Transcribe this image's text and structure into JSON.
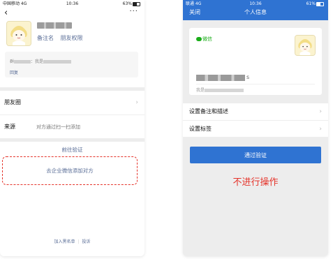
{
  "left_phone": {
    "status_bar": {
      "carrier": "中国移动 4G",
      "time": "10:36",
      "battery": "63%"
    },
    "nav": {
      "back_icon": "chevron-left-icon",
      "more_icon": "more-icon",
      "more_label": "···"
    },
    "profile": {
      "remark_label": "备注名",
      "permission_label": "朋友权限"
    },
    "greeting": {
      "prefix": "群",
      "middle": "：我是",
      "reply_label": "回复"
    },
    "rows": [
      {
        "label": "朋友圈",
        "value": ""
      },
      {
        "label": "来源",
        "value": "对方通过扫一扫添加"
      }
    ],
    "actions": {
      "verify_label": "前往验证",
      "add_via_wecom_label": "去企业微信添加对方"
    },
    "footer": {
      "blacklist_label": "加入黑名单",
      "separator": "|",
      "report_label": "投诉"
    }
  },
  "right_phone": {
    "status_bar": {
      "carrier": "联通 4G",
      "time": "10:36",
      "battery": "61%"
    },
    "nav": {
      "close_label": "关闭",
      "title": "个人信息"
    },
    "card": {
      "wechat_label": "微信",
      "name_suffix": "s",
      "id_prefix": "我是"
    },
    "rows": [
      {
        "label": "设置备注和描述"
      },
      {
        "label": "设置标签"
      }
    ],
    "verify_button_label": "通过验证",
    "note": "不进行操作"
  },
  "colors": {
    "link_blue": "#576b95",
    "wecom_blue": "#2f73d2",
    "wechat_green": "#1aad19",
    "annotation_red": "#e5332a"
  }
}
